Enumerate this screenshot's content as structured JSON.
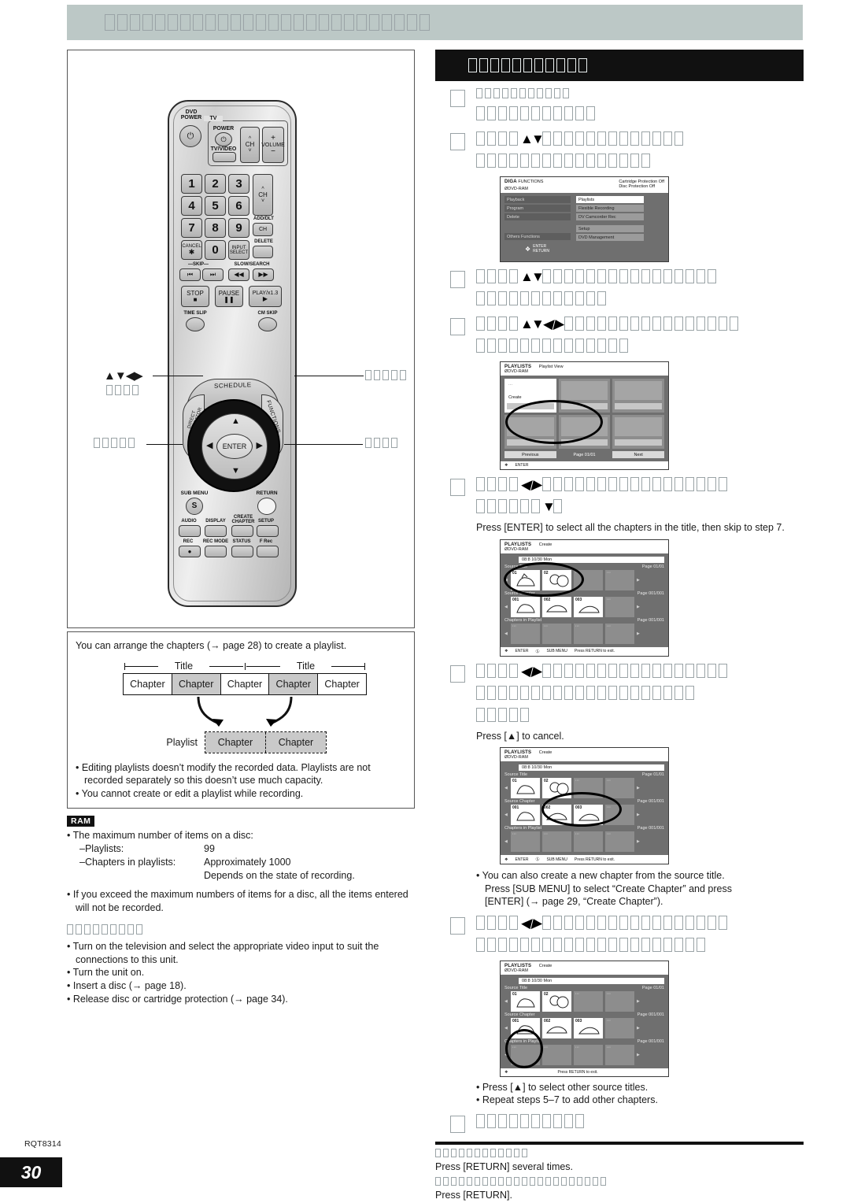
{
  "document": {
    "code": "RQT8314",
    "page_number": "30",
    "banner_glyph_count": 26,
    "section_head_glyph_count": 11
  },
  "left": {
    "diagram": {
      "intro": "You can arrange the chapters (→ page 28) to create a playlist.",
      "title_label": "Title",
      "titles": [
        "Title",
        "Title"
      ],
      "chapters": [
        {
          "label": "Chapter",
          "selected": false
        },
        {
          "label": "Chapter",
          "selected": true
        },
        {
          "label": "Chapter",
          "selected": false
        },
        {
          "label": "Chapter",
          "selected": true
        },
        {
          "label": "Chapter",
          "selected": false
        }
      ],
      "playlist_label": "Playlist",
      "playlist_chapters": [
        "Chapter",
        "Chapter"
      ],
      "notes": [
        "• Editing playlists doesn’t modify the recorded data. Playlists are not recorded separately so this doesn’t use much capacity.",
        "• You cannot create or edit a playlist while recording."
      ]
    },
    "ram": {
      "badge": "RAM",
      "max_items_head": "• The maximum number of items on a disc:",
      "rows": [
        {
          "key": "–Playlists:",
          "value": "99"
        },
        {
          "key": "–Chapters in playlists:",
          "value": "Approximately 1000"
        },
        {
          "key": "",
          "value": "Depends on the state of recording."
        }
      ],
      "exceed_note": "• If you exceed the maximum numbers of items for a disc, all the items entered will not be recorded.",
      "prep_head_glyph_count": 9,
      "prep_items": [
        "• Turn on the television and select the appropriate video input to suit the connections to this unit.",
        "• Turn the unit on.",
        "• Insert a disc (→ page 18).",
        "• Release disc or cartridge protection (→ page 34)."
      ]
    },
    "remote": {
      "dvd_power_label": "DVD\nPOWER",
      "tv_group_label": "TV",
      "tv_power_label": "POWER",
      "tv_video_label": "TV/VIDEO",
      "ch_label": "CH",
      "volume_label": "VOLUME",
      "numbers": [
        "1",
        "2",
        "3",
        "4",
        "5",
        "6",
        "7",
        "8",
        "9",
        "0"
      ],
      "add_dlt_label": "ADD/DLT",
      "add_dlt_ch": "CH",
      "delete_label": "DELETE",
      "cancel_label": "CANCEL",
      "cancel_glyph": "✱",
      "input_select_label": "INPUT\nSELECT",
      "skip_label": "SKIP",
      "slow_search_label": "SLOW/SEARCH",
      "stop_label": "STOP",
      "pause_label": "PAUSE",
      "play_label": "PLAY/x1.3",
      "time_slip_label": "TIME SLIP",
      "cm_skip_label": "CM SKIP",
      "schedule_label": "SCHEDULE",
      "functions_label": "FUNCTIONS",
      "direct_nav_label": "DIRECT NAVIGATOR",
      "enter_label": "ENTER",
      "sub_menu_label": "SUB MENU",
      "sub_menu_glyph": "S",
      "return_label": "RETURN",
      "bottom_buttons": [
        "AUDIO",
        "DISPLAY",
        "CREATE\nCHAPTER",
        "SETUP",
        "REC",
        "REC MODE",
        "STATUS",
        "F Rec"
      ]
    },
    "callouts": {
      "dpad_arrows": "▲▼◀▶",
      "dpad_glyph_count": 4,
      "functions_glyph_count": 5,
      "submenu_glyph_count": 5,
      "return_glyph_count": 4
    }
  },
  "right": {
    "steps": [
      {
        "lines": [
          {
            "glyphs": 11,
            "size": "t13",
            "arrows": []
          },
          {
            "glyphs": 11,
            "size": "t18",
            "arrows": []
          }
        ],
        "plain": []
      },
      {
        "lines": [
          {
            "glyphs": 17,
            "size": "t18",
            "arrows": [
              "▲",
              "▼"
            ],
            "arrow_at": 4
          },
          {
            "glyphs": 16,
            "size": "t18",
            "arrows": []
          }
        ],
        "plain": []
      },
      {
        "lines": [
          {
            "glyphs": 20,
            "size": "t18",
            "arrows": [
              "▲",
              "▼"
            ],
            "arrow_at": 4
          },
          {
            "glyphs": 12,
            "size": "t18",
            "arrows": []
          }
        ],
        "plain": []
      },
      {
        "lines": [
          {
            "glyphs": 20,
            "size": "t18",
            "arrows": [
              "▲",
              "▼",
              "◀",
              "▶"
            ],
            "arrow_at": 4
          },
          {
            "glyphs": 14,
            "size": "t18",
            "arrows": []
          }
        ],
        "plain": []
      },
      {
        "lines": [
          {
            "glyphs": 21,
            "size": "t18",
            "arrows": [
              "◀",
              "▶"
            ],
            "arrow_at": 4
          },
          {
            "glyphs": 7,
            "size": "t18",
            "arrows": [
              "▼"
            ],
            "arrow_at": 6
          }
        ],
        "plain": [
          "Press [ENTER] to select all the chapters in the title, then skip to step 7."
        ]
      },
      {
        "lines": [
          {
            "glyphs": 21,
            "size": "t18",
            "arrows": [
              "◀",
              "▶"
            ],
            "arrow_at": 4
          },
          {
            "glyphs": 20,
            "size": "t18",
            "arrows": []
          },
          {
            "glyphs": 5,
            "size": "t18",
            "arrows": []
          }
        ],
        "plain": [
          "Press [▲] to cancel."
        ]
      },
      {
        "lines": [
          {
            "glyphs": 21,
            "size": "t18",
            "arrows": [
              "◀",
              "▶"
            ],
            "arrow_at": 4
          },
          {
            "glyphs": 21,
            "size": "t18",
            "arrows": []
          }
        ],
        "plain": []
      },
      {
        "lines": [
          {
            "glyphs": 10,
            "size": "t18",
            "arrows": []
          }
        ],
        "plain": []
      }
    ],
    "note_after_step6": [
      "• You can also create a new chapter from the source title.",
      "Press [SUB MENU] to select “Create Chapter” and press",
      "[ENTER] (→ page 29, “Create Chapter”)."
    ],
    "note_after_step7": [
      "• Press [▲] to select other source titles.",
      "• Repeat steps 5–7 to add other chapters."
    ],
    "footer_blocks": [
      {
        "glyphs": 12,
        "text": "Press [RETURN] several times."
      },
      {
        "glyphs": 22,
        "text": "Press [RETURN]."
      }
    ],
    "osd": {
      "functions": {
        "brand": "DIGA",
        "title": "FUNCTIONS",
        "disc": "DVD-RAM",
        "protections": [
          "Cartridge Protection   Off",
          "Disc Protection   Off"
        ],
        "left_items": [
          "Playback",
          "Program",
          "Delete"
        ],
        "others": "Others Functions",
        "right_items_group1": [
          "Playlists",
          "Flexible Recording",
          "DV Camcorder Rec"
        ],
        "right_items_group2": [
          "Setup",
          "DVD Management"
        ],
        "selected": "Playlists",
        "foot": [
          "ENTER",
          "RETURN"
        ]
      },
      "playlist_view": {
        "title": "PLAYLISTS",
        "subtitle": "Playlist View",
        "disc": "DVD-RAM",
        "create_label": "Create",
        "nav": [
          "Previous",
          "Page   01/01",
          "Next"
        ],
        "foot": [
          "ENTER"
        ]
      },
      "create_source_title": {
        "title": "PLAYLISTS",
        "subtitle": "Create",
        "disc": "DVD-RAM",
        "band": "08:8  10/30  Mon",
        "rows": [
          {
            "label": "Source Title",
            "page": "Page   01/01",
            "items": [
              "01",
              "02",
              "",
              ""
            ]
          },
          {
            "label": "Source Chapter",
            "page": "Page   001/001",
            "items": [
              "001",
              "002",
              "003",
              ""
            ]
          },
          {
            "label": "Chapters in Playlist",
            "page": "Page   001/001",
            "items": [
              "",
              "",
              "",
              ""
            ]
          }
        ],
        "foot": [
          "ENTER",
          "SUB MENU",
          "Press RETURN to exit."
        ]
      },
      "create_source_chapter": {
        "title": "PLAYLISTS",
        "subtitle": "Create",
        "disc": "DVD-RAM",
        "band": "08:8  10/30  Mon",
        "rows": [
          {
            "label": "Source Title",
            "page": "Page   01/01",
            "items": [
              "01",
              "02",
              "",
              ""
            ]
          },
          {
            "label": "Source Chapter",
            "page": "Page   001/001",
            "items": [
              "001",
              "002",
              "003",
              ""
            ]
          },
          {
            "label": "Chapters in Playlist",
            "page": "Page   001/001",
            "items": [
              "",
              "",
              "",
              ""
            ]
          }
        ],
        "foot": [
          "ENTER",
          "SUB MENU",
          "Press RETURN to exit."
        ]
      },
      "create_insert": {
        "title": "PLAYLISTS",
        "subtitle": "Create",
        "disc": "DVD-RAM",
        "band": "08:8  10/30  Mon",
        "rows": [
          {
            "label": "Source Title",
            "page": "Page   01/01",
            "items": [
              "01",
              "02",
              "",
              ""
            ]
          },
          {
            "label": "Source Chapter",
            "page": "Page   001/001",
            "items": [
              "001",
              "002",
              "003",
              ""
            ]
          },
          {
            "label": "Chapters in Playlist",
            "page": "Page   001/001",
            "items": [
              "",
              "",
              "",
              ""
            ]
          }
        ],
        "foot": [
          "Press RETURN to exit."
        ]
      }
    }
  }
}
